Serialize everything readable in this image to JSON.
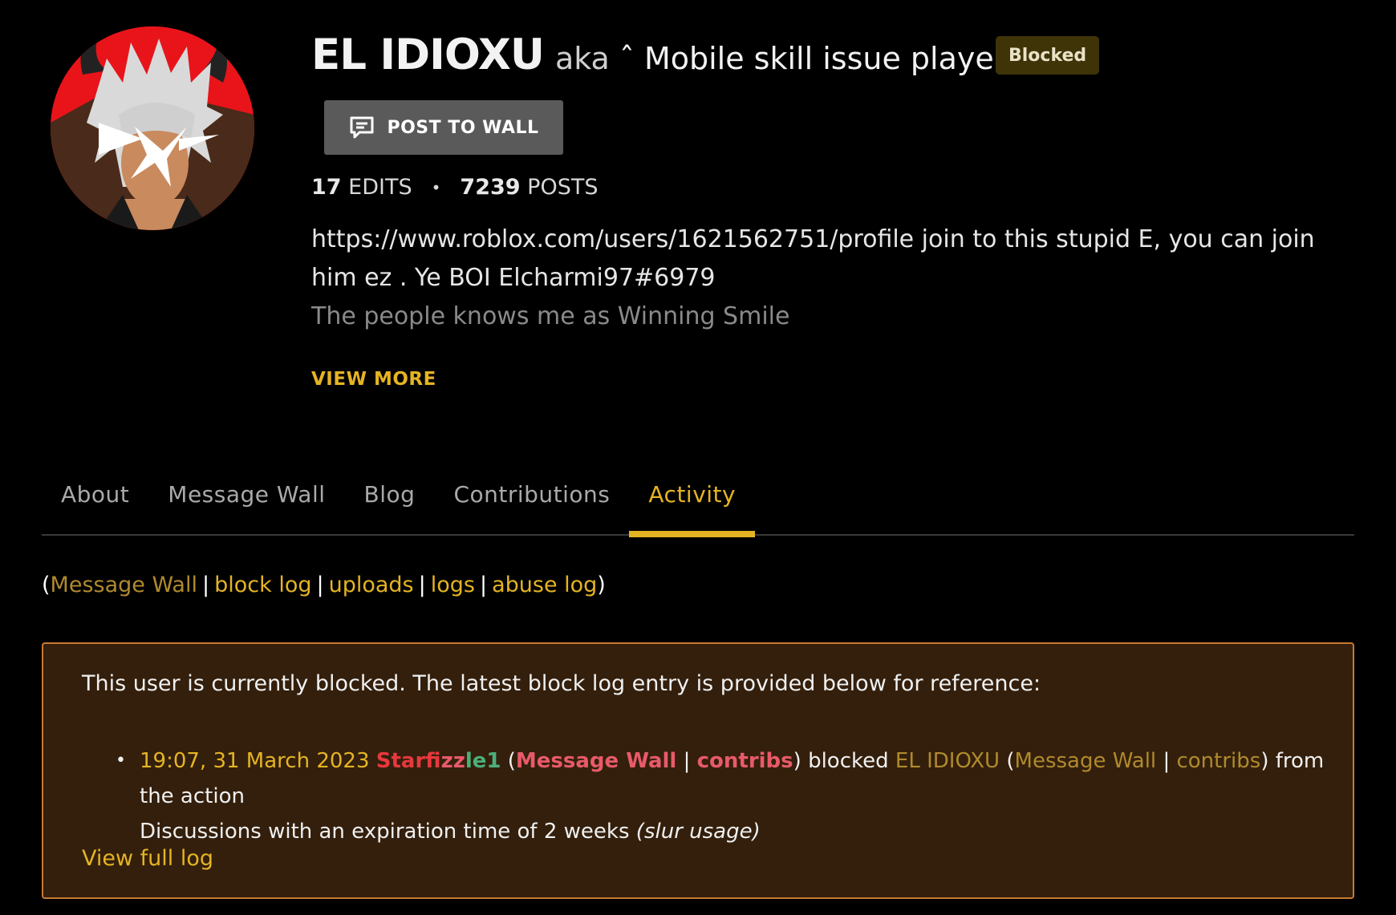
{
  "profile": {
    "username": "EL IDIOXU",
    "aka": "aka",
    "nickname": "ˆ Mobile skill issue player",
    "badge": "Blocked",
    "post_button": "POST TO WALL",
    "edits_count": "17",
    "edits_label": "EDITS",
    "posts_count": "7239",
    "posts_label": "POSTS",
    "bio_line1": "https://www.roblox.com/users/1621562751/profile join to this stupid E, you can join",
    "bio_line2": "him ez . Ye BOI Elcharmi97#6979",
    "bio_line3": "The people knows me as Winning Smile",
    "view_more": "VIEW MORE"
  },
  "tabs": [
    {
      "label": "About"
    },
    {
      "label": "Message Wall"
    },
    {
      "label": "Blog"
    },
    {
      "label": "Contributions"
    },
    {
      "label": "Activity"
    }
  ],
  "tool_links": {
    "message_wall": "Message Wall",
    "block_log": "block log",
    "uploads": "uploads",
    "logs": "logs",
    "abuse_log": "abuse log"
  },
  "block_notice": {
    "intro": "This user is currently blocked. The latest block log entry is provided below for reference:",
    "timestamp": "19:07, 31 March 2023",
    "admin_name": "Starfizzle1",
    "admin_wall": "Message Wall",
    "admin_contribs": "contribs",
    "action_text": "blocked",
    "target_name": "EL IDIOXU",
    "target_wall": "Message Wall",
    "target_contribs": "contribs",
    "after_text": "from the action",
    "line2": "Discussions with an expiration time of 2 weeks",
    "reason": "(slur usage)",
    "view_full_log": "View full log"
  },
  "colors": {
    "accent_gold": "#e5b423",
    "badge_bg": "#3f3308",
    "notice_bg": "#331f0c",
    "notice_border": "#c87a30"
  }
}
